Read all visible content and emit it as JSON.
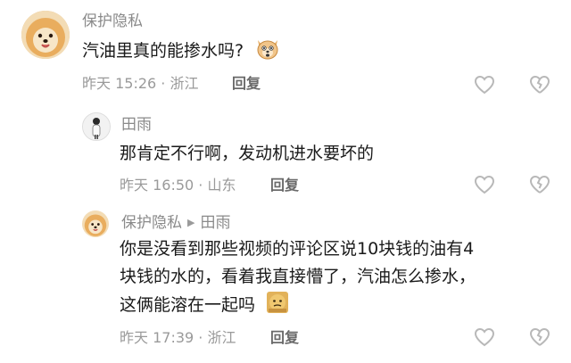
{
  "comments": [
    {
      "username": "保护隐私",
      "text": "汽油里真的能掺水吗?",
      "time": "昨天 15:26",
      "location": "浙江",
      "reply_label": "回复",
      "emoji": "dog-face-emoji"
    },
    {
      "username": "田雨",
      "text": "那肯定不行啊，发动机进水要坏的",
      "time": "昨天 16:50",
      "location": "山东",
      "reply_label": "回复"
    },
    {
      "username": "保护隐私",
      "reply_to": "田雨",
      "text_lines": [
        "你是没看到那些视频的评论区说10块钱的油有4",
        "块钱的水的，看着我直接懵了，汽油怎么掺水，",
        "这俩能溶在一起吗"
      ],
      "time": "昨天 17:39",
      "location": "浙江",
      "reply_label": "回复",
      "emoji": "confused-face-emoji"
    }
  ],
  "separator": "·",
  "icons": {
    "like": "heart-icon",
    "dislike": "broken-heart-icon",
    "reply_arrow": "triangle-right-icon"
  },
  "colors": {
    "text": "#1a1a1a",
    "meta": "#9a9a9a",
    "icon": "#b8b8b8"
  }
}
